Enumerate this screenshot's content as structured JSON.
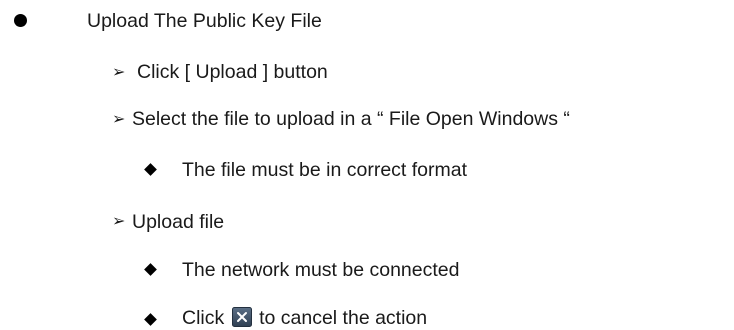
{
  "section": {
    "title": "Upload The Public Key File",
    "steps": [
      {
        "label": "Click [ Upload ] button",
        "notes": []
      },
      {
        "label": "Select the file to upload in a “ File Open Windows “",
        "notes": [
          "The file must be in correct format"
        ]
      },
      {
        "label": "Upload file",
        "notes": [
          "The network must be connected",
          {
            "before": "Click",
            "icon": "close-icon",
            "after": "to cancel the action"
          }
        ]
      }
    ]
  }
}
